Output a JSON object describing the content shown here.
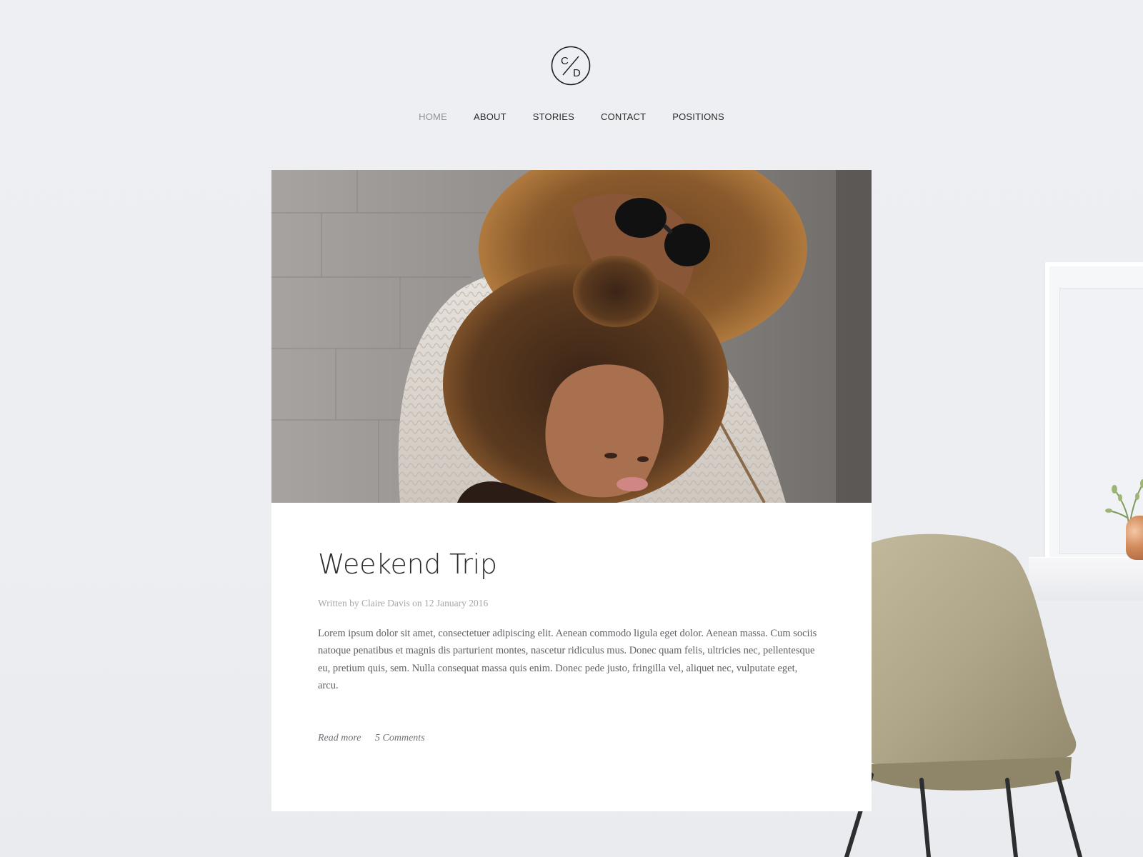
{
  "brand": {
    "logo_top": "C",
    "logo_bottom": "D"
  },
  "nav": {
    "items": [
      {
        "label": "HOME",
        "active": true
      },
      {
        "label": "ABOUT",
        "active": false
      },
      {
        "label": "STORIES",
        "active": false
      },
      {
        "label": "CONTACT",
        "active": false
      },
      {
        "label": "POSITIONS",
        "active": false
      }
    ]
  },
  "post": {
    "title": "Weekend Trip",
    "meta": "Written by Claire Davis on 12 January 2016",
    "excerpt": "Lorem ipsum dolor sit amet, consectetuer adipiscing elit. Aenean commodo ligula eget dolor. Aenean massa. Cum sociis natoque penatibus et magnis dis parturient montes, nascetur ridiculus mus. Donec quam felis, ultricies nec, pellentesque eu, pretium quis, sem. Nulla consequat massa quis enim. Donec pede justo, fringilla vel, aliquet nec, vulputate eget, arcu.",
    "read_more": "Read more",
    "comments": "5 Comments",
    "image_icon": "photo-mother-daughter-image"
  },
  "colors": {
    "background": "#eeeff3",
    "card": "#ffffff",
    "nav_active": "#8f9196",
    "text": "#2b2b2b",
    "meta": "#a5a7ab"
  }
}
